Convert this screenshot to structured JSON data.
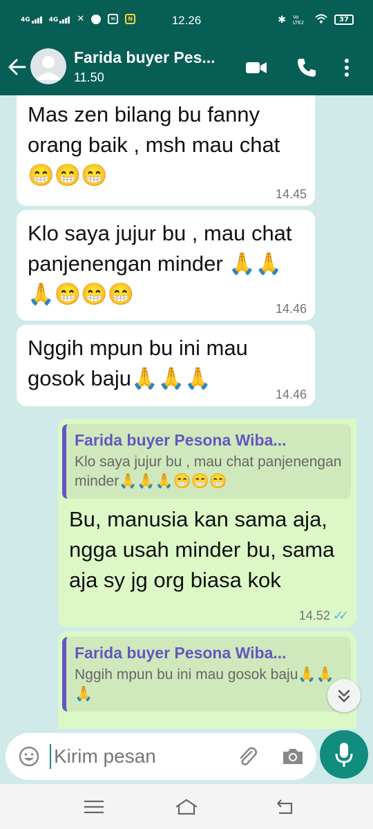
{
  "status_bar": {
    "network_1": "4G",
    "network_2": "4G",
    "time": "12.26",
    "volte": "Vo LTE2",
    "battery": "37"
  },
  "header": {
    "title": "Farida buyer Pes...",
    "subtitle": "11.50"
  },
  "messages": [
    {
      "direction": "in",
      "text": "Mas zen bilang    bu fanny orang baik ,  msh mau chat 😁😁😁",
      "time": "14.45"
    },
    {
      "direction": "in",
      "text": "Klo saya jujur bu , mau chat panjenengan minder 🙏🙏🙏😁😁😁",
      "time": "14.46"
    },
    {
      "direction": "in",
      "text": "Nggih mpun bu ini mau gosok baju🙏🙏🙏",
      "time": "14.46"
    },
    {
      "direction": "out",
      "quote_author": "Farida buyer Pesona Wiba...",
      "quote_text": "Klo saya jujur bu , mau chat panjenengan minder🙏🙏🙏😁😁😁",
      "text": "Bu, manusia kan sama aja, ngga usah minder bu, sama aja sy jg org biasa kok",
      "time": "14.52"
    },
    {
      "direction": "out",
      "quote_author": "Farida buyer Pesona Wiba...",
      "quote_text": "Nggih mpun bu ini mau gosok baju🙏🙏🙏",
      "text": "",
      "time": ""
    }
  ],
  "composer": {
    "placeholder": "Kirim pesan"
  },
  "icons": {
    "back": "arrow-back-icon",
    "video": "video-call-icon",
    "call": "phone-icon",
    "menu": "more-vert-icon",
    "emoji": "emoji-icon",
    "attach": "attach-icon",
    "camera": "camera-icon",
    "mic": "mic-icon",
    "scroll": "chevron-double-down-icon"
  },
  "colors": {
    "header": "#075e54",
    "chat_bg": "#cfeae8",
    "incoming": "#ffffff",
    "outgoing": "#dcf8c6",
    "accent": "#128c7e",
    "quote_author": "#6556c2",
    "read_ticks": "#4fb6ec"
  }
}
